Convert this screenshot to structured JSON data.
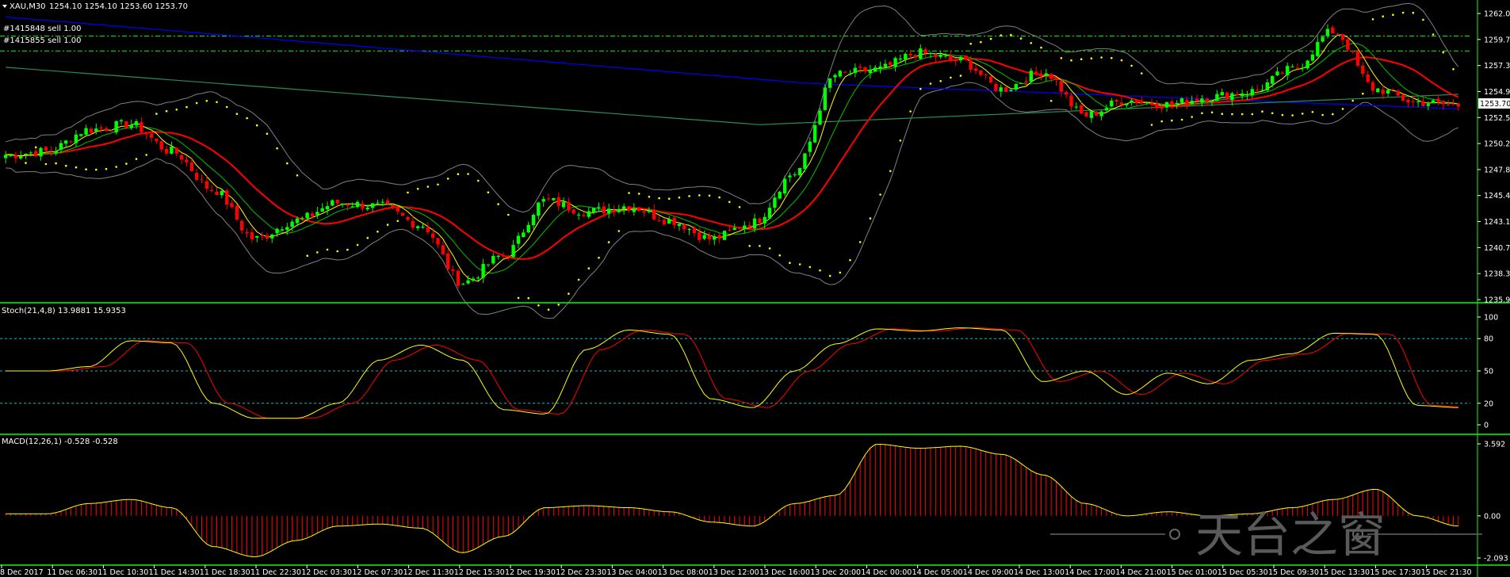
{
  "window": {
    "title": "XAU,M30",
    "ohlc": "1254.10 1254.10 1253.60 1253.70",
    "orders": [
      "#1415848 sell 1.00",
      "#1415855 sell 1.00"
    ],
    "current_price": "1253.70"
  },
  "price_axis": {
    "ticks": [
      "1262.05",
      "1259.70",
      "1257.30",
      "1254.95",
      "1252.55",
      "1250.20",
      "1247.85",
      "1245.45",
      "1243.10",
      "1240.70",
      "1238.35",
      "1235.95"
    ],
    "min": 1235.95,
    "max": 1262.05
  },
  "stoch_panel": {
    "label": "Stoch(21,4,8) 13.9881 15.9353",
    "ticks": [
      "100",
      "80",
      "50",
      "20",
      "0"
    ],
    "levels": [
      80,
      50,
      20
    ]
  },
  "macd_panel": {
    "label": "MACD(12,26,1) -0.528 -0.528",
    "ticks": [
      "3.592",
      "0.00",
      "-2.093"
    ],
    "max": 3.592,
    "min": -2.093
  },
  "time_axis": {
    "labels": [
      "8 Dec 2017",
      "11 Dec 06:30",
      "11 Dec 10:30",
      "11 Dec 14:30",
      "11 Dec 18:30",
      "11 Dec 22:30",
      "12 Dec 03:30",
      "12 Dec 07:30",
      "12 Dec 11:30",
      "12 Dec 15:30",
      "12 Dec 19:30",
      "12 Dec 23:30",
      "13 Dec 04:00",
      "13 Dec 08:00",
      "13 Dec 12:00",
      "13 Dec 16:00",
      "13 Dec 20:00",
      "14 Dec 00:00",
      "14 Dec 05:00",
      "14 Dec 09:00",
      "14 Dec 13:00",
      "14 Dec 17:00",
      "14 Dec 21:00",
      "15 Dec 01:00",
      "15 Dec 05:30",
      "15 Dec 09:30",
      "15 Dec 13:30",
      "15 Dec 17:30",
      "15 Dec 21:30"
    ]
  },
  "watermark": {
    "text": "天台之窗"
  },
  "colors": {
    "bull": "#00ff00",
    "bear": "#ff0000",
    "ma_fast": "#ffff00",
    "ma_mid": "#00c000",
    "ma_slow": "#ff0000",
    "ma_200": "#0000ff",
    "ma_long": "#2e8b57",
    "bands": "#808080",
    "sar": "#ffff00",
    "grid": "#00ff00",
    "stoch_main": "#ffff00",
    "stoch_signal": "#ff0000",
    "macd": "#ff0000",
    "macd_signal": "#ffff00",
    "order_line": "#00ff00"
  },
  "chart_data": {
    "type": "candlestick",
    "symbol": "XAU",
    "timeframe": "M30",
    "price_range": [
      1235.95,
      1262.05
    ],
    "price_waypoints": [
      1249.2,
      1249.5,
      1251.5,
      1252.0,
      1249.5,
      1246.0,
      1241.5,
      1243.2,
      1244.8,
      1244.5,
      1242.8,
      1237.5,
      1240.0,
      1245.0,
      1244.0,
      1244.5,
      1243.2,
      1241.5,
      1243.0,
      1247.5,
      1256.5,
      1257.0,
      1258.5,
      1257.8,
      1255.2,
      1256.8,
      1252.8,
      1254.2,
      1253.8,
      1254.5,
      1255.0,
      1257.0,
      1260.5,
      1255.2,
      1254.0,
      1253.7
    ],
    "stoch_waypoints": [
      50,
      50,
      54,
      78,
      76,
      20,
      6,
      6,
      20,
      60,
      74,
      60,
      14,
      10,
      70,
      88,
      84,
      24,
      16,
      50,
      75,
      89,
      87,
      90,
      88,
      40,
      50,
      28,
      48,
      38,
      60,
      66,
      85,
      84,
      18,
      16
    ],
    "macd_waypoints": [
      0.1,
      0.1,
      0.6,
      0.8,
      0.4,
      -1.5,
      -2.0,
      -1.2,
      -0.5,
      -0.4,
      -0.6,
      -1.8,
      -1.0,
      0.4,
      0.5,
      0.4,
      0.2,
      -0.3,
      -0.5,
      0.6,
      1.0,
      3.5,
      3.3,
      3.4,
      3.0,
      2.0,
      0.6,
      0.0,
      0.2,
      0.0,
      0.1,
      0.4,
      0.8,
      1.3,
      0.0,
      -0.5
    ]
  }
}
